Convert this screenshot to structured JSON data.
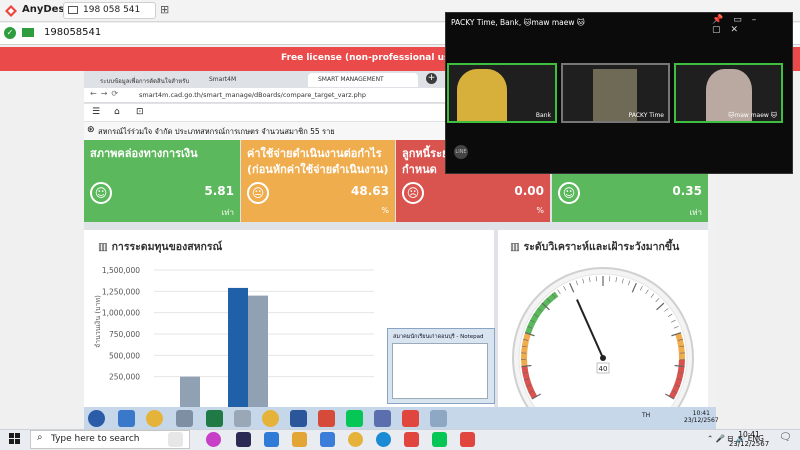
{
  "anydesk": {
    "app_name": "AnyDesk",
    "tab_label": "198 058 541",
    "address": "198058541",
    "license_banner": "Free license (non-professional use). Start t"
  },
  "browser": {
    "tabs": [
      {
        "label": "ระบบข้อมูลเพื่อการตัดสินใจสำหรับ"
      },
      {
        "label": "Smart4M"
      },
      {
        "label": "SMART MANAGEMENT"
      }
    ],
    "url": "smart4m.cad.go.th/smart_manage/dBoards/compare_target_varz.php"
  },
  "page": {
    "coop_line": "สหกรณ์ไร่ร่วมใจ จำกัด ประเภทสหกรณ์การเกษตร จำนวนสมาชิก 55 ราย",
    "cards": [
      {
        "title": "สภาพคล่องทางการเงิน",
        "value": "5.81",
        "unit": "เท่า",
        "face": "☺",
        "color": "#5cb85c"
      },
      {
        "title": "ค่าใช้จ่ายดำเนินงานต่อกำไร (ก่อนหักค่าใช้จ่ายดำเนินงาน)",
        "value": "48.63",
        "unit": "%",
        "face": "😐",
        "color": "#f0ad4e"
      },
      {
        "title": "ลูกหนี้ระย กำหนด",
        "value": "0.00",
        "unit": "%",
        "face": "☹",
        "color": "#d9534f"
      },
      {
        "title": "",
        "value": "0.35",
        "unit": "เท่า",
        "face": "☺",
        "color": "#5cb85c"
      }
    ],
    "left_panel_title": "การระดมทุนของสหกรณ์",
    "right_panel_title": "ระดับวิเคราะห์และเฝ้าระวังมากขึ้น"
  },
  "chart_data": [
    {
      "type": "bar",
      "ylabel": "จำนวนเงิน (บาท)",
      "ylim": [
        0,
        1500000
      ],
      "yticks": [
        "1,500,000",
        "1,250,000",
        "1,000,000",
        "750,000",
        "500,000",
        "250,000"
      ],
      "series": [
        {
          "color": "#8fa1b3",
          "values": [
            250000,
            0
          ]
        },
        {
          "color": "#2060a8",
          "values": [
            0,
            1290000
          ]
        },
        {
          "color": "#8fa1b3",
          "values": [
            0,
            1200000
          ]
        }
      ]
    },
    {
      "type": "gauge",
      "value": 40,
      "label": "40"
    }
  ],
  "notepad": {
    "title": "สมาคมนักเรียนเก่าดอนบุรี - Notepad"
  },
  "remote_taskbar": {
    "lang": "TH",
    "time": "10:41",
    "date": "23/12/2567"
  },
  "video_call": {
    "title": "PACKY Time, Bank, 🐱maw maew 🐱",
    "participants": [
      {
        "name": "Bank"
      },
      {
        "name": "PACKY Time"
      },
      {
        "name": "🐱maw maew 🐱"
      }
    ]
  },
  "taskbar": {
    "search_placeholder": "Type here to search",
    "lang": "ENG",
    "time": "10:41",
    "date": "23/12/2567"
  }
}
